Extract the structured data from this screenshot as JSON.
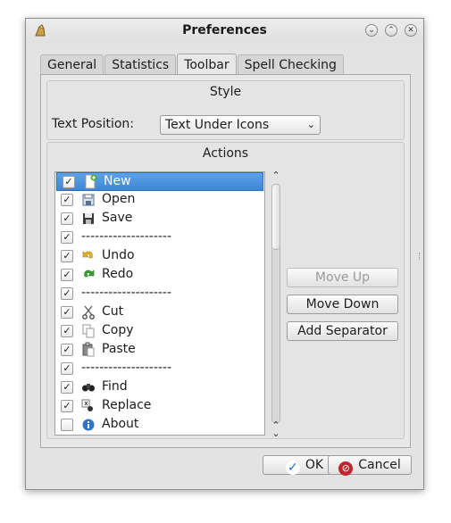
{
  "window": {
    "title": "Preferences"
  },
  "tabs": [
    {
      "label": "General",
      "active": false
    },
    {
      "label": "Statistics",
      "active": false
    },
    {
      "label": "Toolbar",
      "active": true
    },
    {
      "label": "Spell Checking",
      "active": false
    }
  ],
  "style_group": {
    "title": "Style",
    "text_position_label": "Text Position:",
    "text_position_value": "Text Under Icons"
  },
  "actions_group": {
    "title": "Actions",
    "items": [
      {
        "label": "New",
        "checked": true,
        "icon": "new-document-icon",
        "selected": true
      },
      {
        "label": "Open",
        "checked": true,
        "icon": "open-icon"
      },
      {
        "label": "Save",
        "checked": true,
        "icon": "save-icon"
      },
      {
        "label": "--------------------",
        "checked": true,
        "icon": ""
      },
      {
        "label": "Undo",
        "checked": true,
        "icon": "undo-icon"
      },
      {
        "label": "Redo",
        "checked": true,
        "icon": "redo-icon"
      },
      {
        "label": "--------------------",
        "checked": true,
        "icon": ""
      },
      {
        "label": "Cut",
        "checked": true,
        "icon": "cut-icon"
      },
      {
        "label": "Copy",
        "checked": true,
        "icon": "copy-icon"
      },
      {
        "label": "Paste",
        "checked": true,
        "icon": "paste-icon"
      },
      {
        "label": "--------------------",
        "checked": true,
        "icon": ""
      },
      {
        "label": "Find",
        "checked": true,
        "icon": "find-icon"
      },
      {
        "label": "Replace",
        "checked": true,
        "icon": "replace-icon"
      },
      {
        "label": "About",
        "checked": false,
        "icon": "about-icon"
      }
    ],
    "move_up_label": "Move Up",
    "move_down_label": "Move Down",
    "add_separator_label": "Add Separator"
  },
  "dialog_buttons": {
    "ok_label": "OK",
    "cancel_label": "Cancel"
  },
  "colors": {
    "selection": "#3f86d6",
    "ok_icon": "#2a6bc4",
    "cancel_icon": "#c0262b"
  }
}
